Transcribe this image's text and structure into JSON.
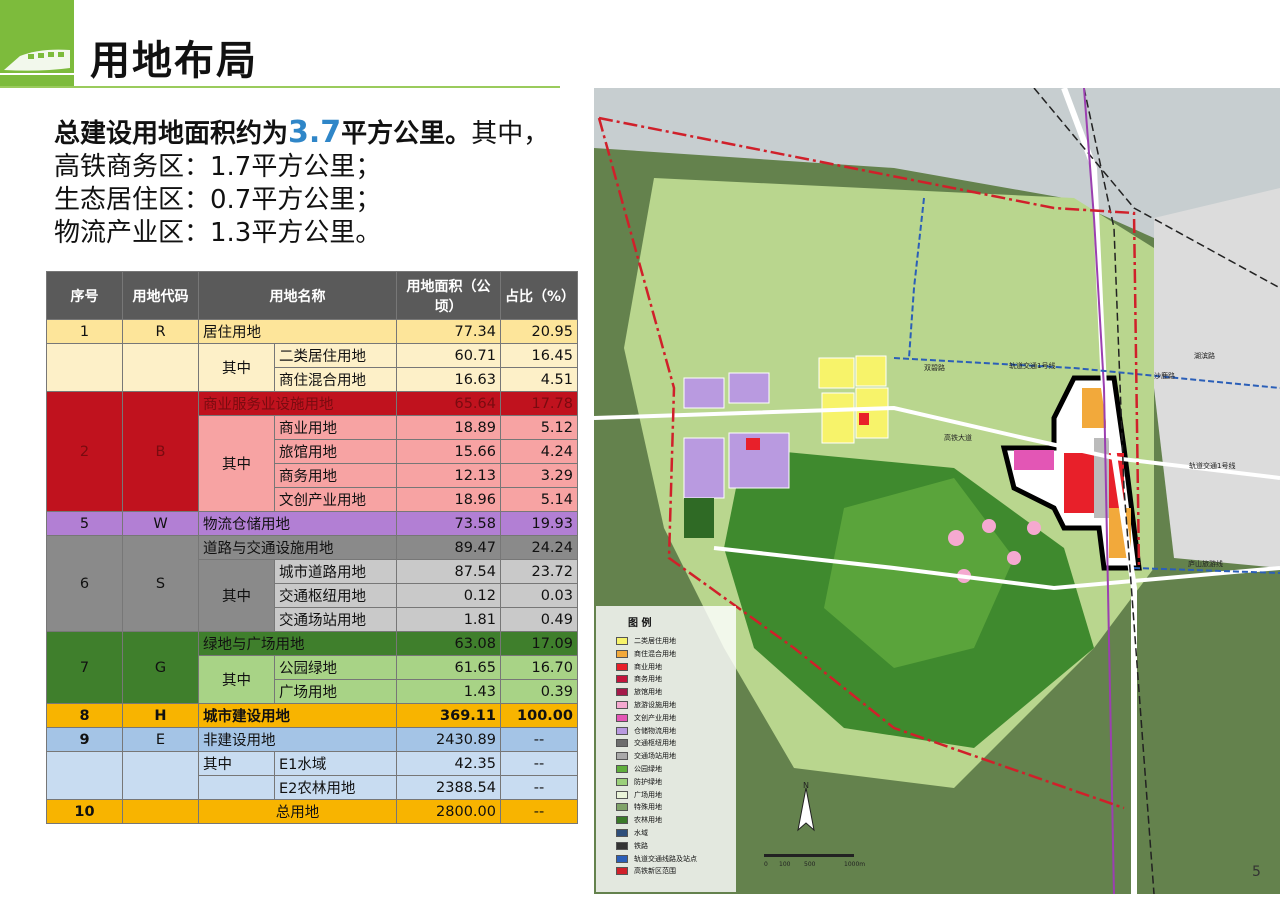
{
  "header": {
    "title": "用地布局"
  },
  "summary": {
    "line1_prefix": "总建设用地面积约为",
    "line1_value": "3.7",
    "line1_suffix": "平方公里。",
    "line1_tail": "其中，",
    "line2": "高铁商务区：1.7平方公里；",
    "line3": "生态居住区：0.7平方公里；",
    "line4": "物流产业区：1.3平方公里。"
  },
  "table": {
    "headers": [
      "序号",
      "用地代码",
      "用地名称",
      "用地面积（公顷）",
      "占比（%）"
    ],
    "rows": [
      [
        "1",
        "R",
        "居住用地",
        "77.34",
        "20.95"
      ],
      [
        "其中",
        "二类居住用地",
        "60.71",
        "16.45"
      ],
      [
        "商住混合用地",
        "16.63",
        "4.51"
      ],
      [
        "2",
        "B",
        "商业服务业设施用地",
        "65.64",
        "17.78"
      ],
      [
        "其中",
        "商业用地",
        "18.89",
        "5.12"
      ],
      [
        "旅馆用地",
        "15.66",
        "4.24"
      ],
      [
        "商务用地",
        "12.13",
        "3.29"
      ],
      [
        "文创产业用地",
        "18.96",
        "5.14"
      ],
      [
        "5",
        "W",
        "物流仓储用地",
        "73.58",
        "19.93"
      ],
      [
        "6",
        "S",
        "道路与交通设施用地",
        "89.47",
        "24.24"
      ],
      [
        "其中",
        "城市道路用地",
        "87.54",
        "23.72"
      ],
      [
        "交通枢纽用地",
        "0.12",
        "0.03"
      ],
      [
        "交通场站用地",
        "1.81",
        "0.49"
      ],
      [
        "7",
        "G",
        "绿地与广场用地",
        "63.08",
        "17.09"
      ],
      [
        "其中",
        "公园绿地",
        "61.65",
        "16.70"
      ],
      [
        "广场用地",
        "1.43",
        "0.39"
      ],
      [
        "8",
        "H",
        "城市建设用地",
        "369.11",
        "100.00"
      ],
      [
        "9",
        "E",
        "非建设用地",
        "2430.89",
        "--"
      ],
      [
        "其中",
        "E1水域",
        "42.35",
        "--"
      ],
      [
        "E2农林用地",
        "2388.54",
        "--"
      ],
      [
        "10",
        "总用地",
        "2800.00",
        "--"
      ]
    ]
  },
  "map": {
    "legend_title": "图  例",
    "legend": [
      {
        "label": "二类居住用地",
        "color": "#f7f36a"
      },
      {
        "label": "商住混合用地",
        "color": "#f2a93b"
      },
      {
        "label": "商业用地",
        "color": "#e8202a"
      },
      {
        "label": "商务用地",
        "color": "#c3143c"
      },
      {
        "label": "旅馆用地",
        "color": "#a51a4a"
      },
      {
        "label": "旅游设施用地",
        "color": "#f5a9d0"
      },
      {
        "label": "文创产业用地",
        "color": "#e356b5"
      },
      {
        "label": "仓储物流用地",
        "color": "#b99ae0"
      },
      {
        "label": "交通枢纽用地",
        "color": "#6d6d6d"
      },
      {
        "label": "交通场站用地",
        "color": "#a9a9a9"
      },
      {
        "label": "公园绿地",
        "color": "#5fae3c"
      },
      {
        "label": "防护绿地",
        "color": "#9bd07a"
      },
      {
        "label": "广场用地",
        "color": "#e9f3d8"
      },
      {
        "label": "特殊用地",
        "color": "#7fa368"
      },
      {
        "label": "农林用地",
        "color": "#3b7a2a"
      },
      {
        "label": "水域",
        "color": "#2e4e7a"
      },
      {
        "label": "铁路",
        "color": "#333333"
      },
      {
        "label": "轨道交通线路及站点",
        "color": "#2b5fb8"
      },
      {
        "label": "高铁新区范围",
        "color": "#d0202a"
      }
    ],
    "road_labels": [
      "双碧路",
      "轨道交通1号线",
      "高铁大道",
      "沙鹿路",
      "轨道交通1号线",
      "庐山旅游线",
      "湖滨路"
    ],
    "scale_labels": [
      "0",
      "100",
      "500",
      "1000m"
    ],
    "north": "N"
  },
  "page_number": "5"
}
